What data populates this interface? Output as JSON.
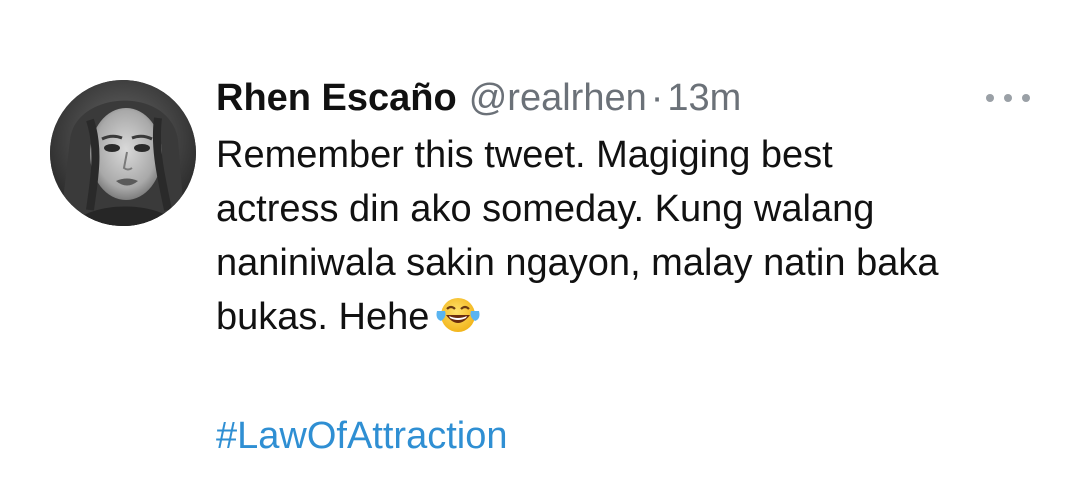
{
  "tweet": {
    "author": {
      "display_name": "Rhen Escaño",
      "handle": "@realrhen",
      "separator": "·",
      "time": "13m",
      "avatar_icon": "profile-photo"
    },
    "text_lines": [
      "Remember this tweet. Magiging best",
      "actress din ako someday. Kung walang",
      "naniniwala sakin ngayon, malay natin baka",
      "bukas. Hehe"
    ],
    "emoji": "face-with-tears-of-joy",
    "hashtag": "#LawOfAttraction",
    "more_icon": "more-horizontal-icon",
    "colors": {
      "hashtag": "#2f8fd3",
      "muted": "#6b7178",
      "text": "#111111"
    }
  }
}
